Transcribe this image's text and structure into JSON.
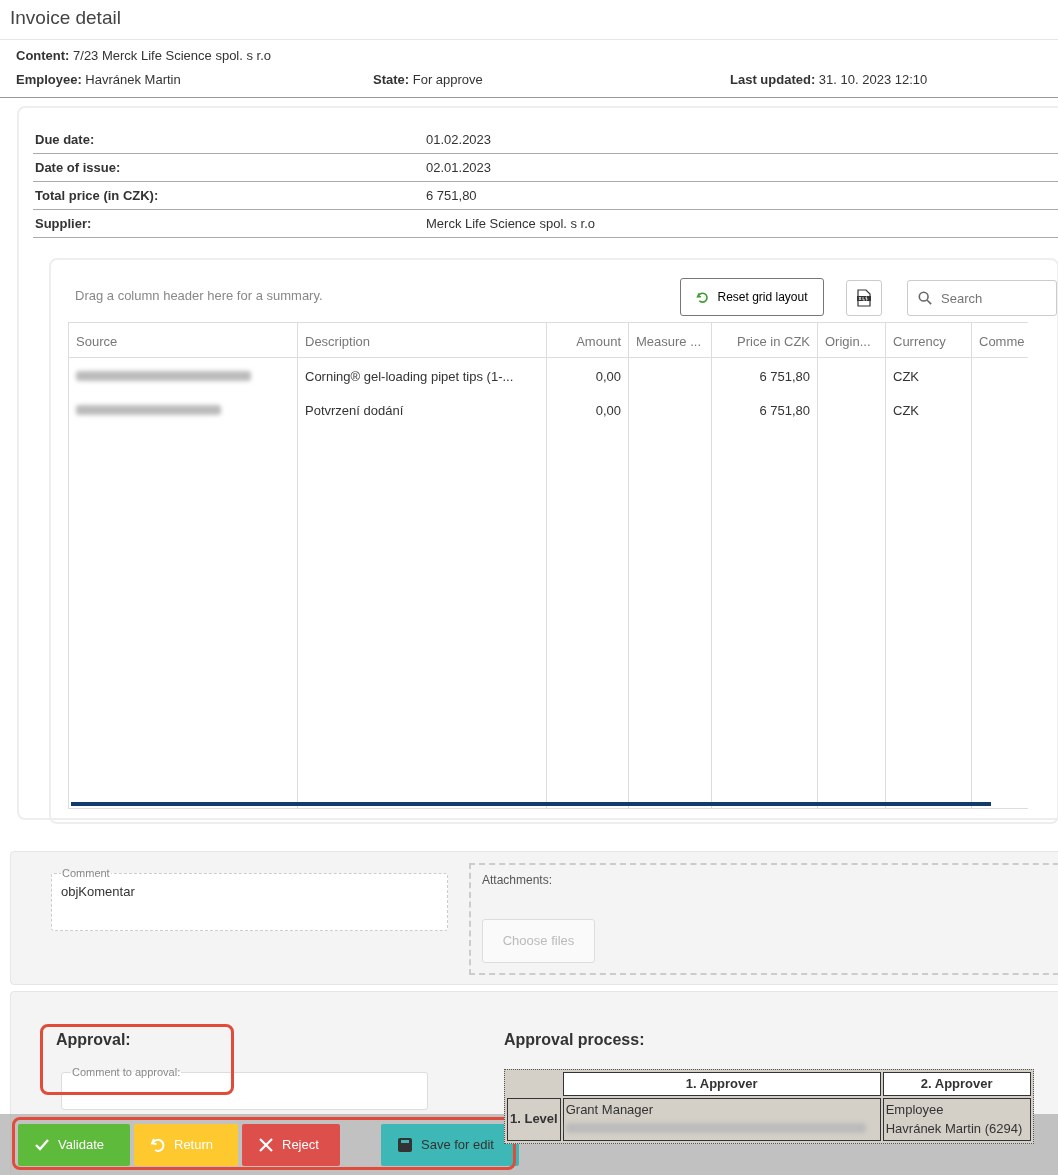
{
  "dialog": {
    "title": "Invoice detail"
  },
  "summary": {
    "content": {
      "label": "Content:",
      "value": "7/23 Merck Life Science spol. s r.o"
    },
    "row": [
      {
        "label": "Employee:",
        "value": "Havránek Martin"
      },
      {
        "label": "State:",
        "value": "For approve"
      },
      {
        "label": "Last updated:",
        "value": "31. 10. 2023 12:10"
      }
    ]
  },
  "fields": [
    {
      "label": "Due date:",
      "value": "01.02.2023"
    },
    {
      "label": "Date of issue:",
      "value": "02.01.2023"
    },
    {
      "label": "Total price (in CZK):",
      "value": "6 751,80"
    },
    {
      "label": "Supplier:",
      "value": "Merck Life Science spol. s r.o"
    }
  ],
  "grid": {
    "hint": "Drag a column header here for a summary.",
    "reset_button": "Reset grid layout",
    "search_placeholder": "Search",
    "columns": [
      {
        "label": "Source"
      },
      {
        "label": "Description"
      },
      {
        "label": "Amount"
      },
      {
        "label": "Measure ..."
      },
      {
        "label": "Price in CZK"
      },
      {
        "label": "Origin..."
      },
      {
        "label": "Currency"
      },
      {
        "label": "Comme"
      }
    ],
    "rows": [
      {
        "description": "Corning® gel-loading pipet tips (1-...",
        "amount": "0,00",
        "price": "6 751,80",
        "currency": "CZK"
      },
      {
        "description": "Potvrzení dodání",
        "amount": "0,00",
        "price": "6 751,80",
        "currency": "CZK"
      }
    ]
  },
  "comment": {
    "label": "Comment",
    "value": "objKomentar"
  },
  "attachments": {
    "label": "Attachments:",
    "button": "Choose files",
    "disabled": true
  },
  "approval": {
    "title": "Approval:",
    "comment_label": "Comment to approval:"
  },
  "approval_process": {
    "title": "Approval process:",
    "columns": [
      "1. Approver",
      "2. Approver"
    ],
    "levels": [
      {
        "label": "1. Level",
        "cells": [
          {
            "role": "Grant Manager"
          },
          {
            "role": "Employee",
            "name": "Havránek Martin (6294)"
          }
        ]
      }
    ]
  },
  "actions": [
    {
      "label": "Validate",
      "kind": "validate"
    },
    {
      "label": "Return",
      "kind": "return"
    },
    {
      "label": "Reject",
      "kind": "reject"
    },
    {
      "label": "Save for edit",
      "kind": "save"
    }
  ]
}
